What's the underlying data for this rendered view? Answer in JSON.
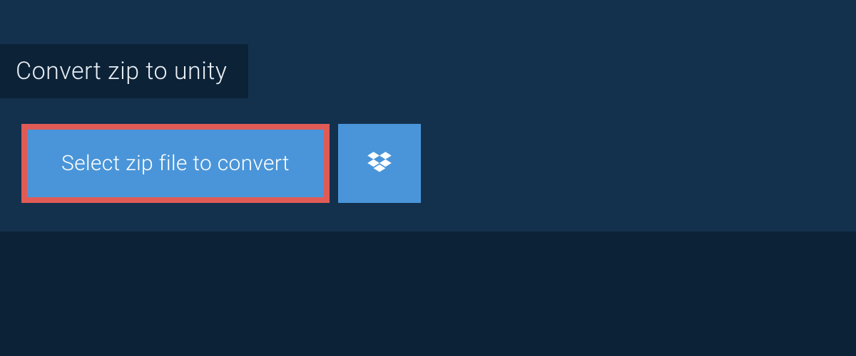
{
  "tab": {
    "title": "Convert zip to unity"
  },
  "actions": {
    "select_file_label": "Select zip file to convert"
  },
  "colors": {
    "page_bg": "#0c2237",
    "banner_bg": "#13314d",
    "button_bg": "#4a95d9",
    "highlight_border": "#e05b56",
    "text_light": "#ffffff"
  }
}
